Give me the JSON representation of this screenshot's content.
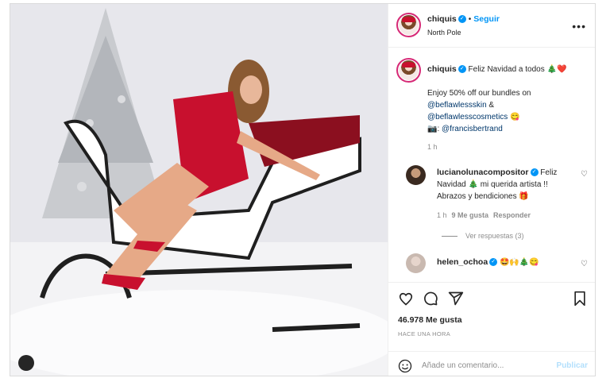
{
  "post": {
    "username": "chiquis",
    "verified_glyph": "✓",
    "dot": "•",
    "follow_label": "Seguir",
    "location": "North Pole",
    "more_glyph": "•••"
  },
  "caption": {
    "username": "chiquis",
    "line1": "Feliz Navidad a todos 🎄❤️",
    "line2": "Enjoy 50% off our bundles on",
    "mention1": "@beflawlessskin",
    "amp": " &",
    "mention2": "@beflawlesscosmetics",
    "mention2_suffix": " 😋",
    "camera": "📷: ",
    "mention3": "@francisbertrand",
    "time": "1 h"
  },
  "comments": [
    {
      "username": "lucianolunacompositor",
      "text_a": "Feliz",
      "text_b": "Navidad 🎄 mi querida artista !!",
      "text_c": "Abrazos y bendiciones 🎁",
      "time": "1 h",
      "likes": "9 Me gusta",
      "reply": "Responder"
    },
    {
      "username": "helen_ochoa",
      "text": "🤩🙌🎄😋"
    }
  ],
  "view_replies": "Ver respuestas (3)",
  "likes_count": "46.978 Me gusta",
  "posted_ago": "HACE UNA HORA",
  "add_comment": {
    "placeholder": "Añade un comentario...",
    "publish": "Publicar"
  },
  "icons": [
    "heart-icon",
    "comment-icon",
    "share-icon",
    "bookmark-icon",
    "emoji-icon",
    "user-tag-icon"
  ],
  "colors": {
    "accent": "#0095f6",
    "link": "#00376b",
    "muted": "#8e8e8e",
    "ring": "#d62976"
  }
}
